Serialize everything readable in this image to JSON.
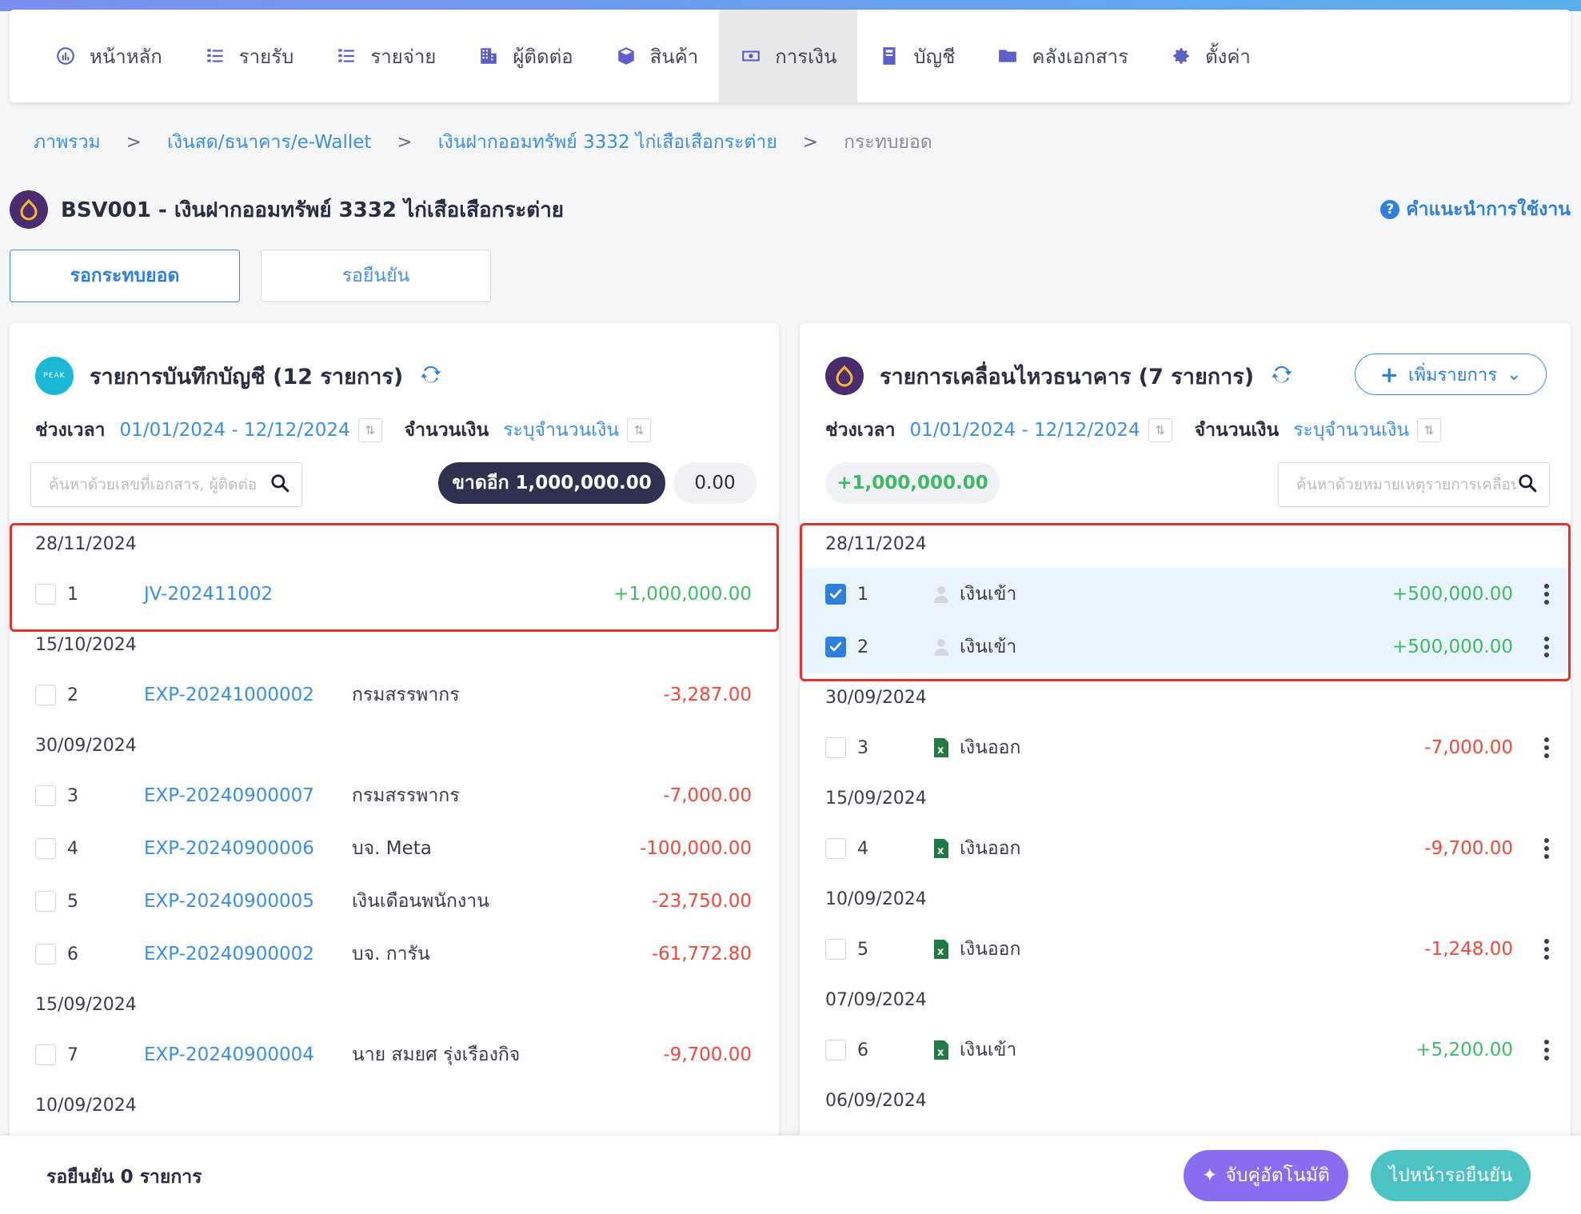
{
  "nav": {
    "items": [
      {
        "label": "หน้าหลัก",
        "icon": "dashboard-icon"
      },
      {
        "label": "รายรับ",
        "icon": "income-list-icon"
      },
      {
        "label": "รายจ่าย",
        "icon": "expense-list-icon"
      },
      {
        "label": "ผู้ติดต่อ",
        "icon": "building-icon"
      },
      {
        "label": "สินค้า",
        "icon": "box-icon"
      },
      {
        "label": "การเงิน",
        "icon": "money-icon",
        "active": true
      },
      {
        "label": "บัญชี",
        "icon": "ledger-icon"
      },
      {
        "label": "คลังเอกสาร",
        "icon": "folder-icon"
      },
      {
        "label": "ตั้งค่า",
        "icon": "gear-icon"
      }
    ]
  },
  "breadcrumb": [
    "ภาพรวม",
    "เงินสด/ธนาคาร/e-Wallet",
    "เงินฝากออมทรัพย์ 3332 ไก่เสือเสือกระต่าย",
    "กระทบยอด"
  ],
  "breadcrumb_sep": ">",
  "page": {
    "title": "BSV001 - เงินฝากออมทรัพย์ 3332 ไก่เสือเสือกระต่าย",
    "help": "คำแนะนำการใช้งาน",
    "help_icon": "?"
  },
  "tabs": {
    "active": "รอกระทบยอด",
    "inactive": "รอยืนยัน"
  },
  "left": {
    "logo_text": "PEAK",
    "title": "รายการบันทึกบัญชี (12 รายการ)",
    "period_label": "ช่วงเวลา",
    "period_value": "01/01/2024 - 12/12/2024",
    "amount_label": "จำนวนเงิน",
    "amount_value": "ระบุจำนวนเงิน",
    "search_placeholder": "ค้นหาด้วยเลขที่เอกสาร, ผู้ติดต่อ",
    "missing": "ขาดอีก 1,000,000.00",
    "total": "0.00",
    "groups": [
      {
        "date": "28/11/2024",
        "rows": [
          {
            "n": "1",
            "doc": "JV-202411002",
            "party": "",
            "amount": "+1,000,000.00",
            "sign": "pos"
          }
        ]
      },
      {
        "date": "15/10/2024",
        "rows": [
          {
            "n": "2",
            "doc": "EXP-20241000002",
            "party": "กรมสรรพากร",
            "amount": "-3,287.00",
            "sign": "neg"
          }
        ]
      },
      {
        "date": "30/09/2024",
        "rows": [
          {
            "n": "3",
            "doc": "EXP-20240900007",
            "party": "กรมสรรพากร",
            "amount": "-7,000.00",
            "sign": "neg"
          },
          {
            "n": "4",
            "doc": "EXP-20240900006",
            "party": "บจ. Meta",
            "amount": "-100,000.00",
            "sign": "neg"
          },
          {
            "n": "5",
            "doc": "EXP-20240900005",
            "party": "เงินเดือนพนักงาน",
            "amount": "-23,750.00",
            "sign": "neg"
          },
          {
            "n": "6",
            "doc": "EXP-20240900002",
            "party": "บจ. การัน",
            "amount": "-61,772.80",
            "sign": "neg"
          }
        ]
      },
      {
        "date": "15/09/2024",
        "rows": [
          {
            "n": "7",
            "doc": "EXP-20240900004",
            "party": "นาย สมยศ รุ่งเรืองกิจ",
            "amount": "-9,700.00",
            "sign": "neg"
          }
        ]
      },
      {
        "date": "10/09/2024",
        "rows": []
      }
    ]
  },
  "right": {
    "title": "รายการเคลื่อนไหวธนาคาร (7 รายการ)",
    "add_label": "เพิ่มรายการ",
    "period_label": "ช่วงเวลา",
    "period_value": "01/01/2024 - 12/12/2024",
    "amount_label": "จำนวนเงิน",
    "amount_value": "ระบุจำนวนเงิน",
    "search_placeholder": "ค้นหาด้วยหมายเหตุรายการเคลื่อนไหว",
    "total": "+1,000,000.00",
    "groups": [
      {
        "date": "28/11/2024",
        "rows": [
          {
            "n": "1",
            "icon": "user-icon",
            "desc": "เงินเข้า",
            "amount": "+500,000.00",
            "sign": "pos",
            "checked": true
          },
          {
            "n": "2",
            "icon": "user-icon",
            "desc": "เงินเข้า",
            "amount": "+500,000.00",
            "sign": "pos",
            "checked": true
          }
        ]
      },
      {
        "date": "30/09/2024",
        "rows": [
          {
            "n": "3",
            "icon": "excel-icon",
            "desc": "เงินออก",
            "amount": "-7,000.00",
            "sign": "neg",
            "checked": false
          }
        ]
      },
      {
        "date": "15/09/2024",
        "rows": [
          {
            "n": "4",
            "icon": "excel-icon",
            "desc": "เงินออก",
            "amount": "-9,700.00",
            "sign": "neg",
            "checked": false
          }
        ]
      },
      {
        "date": "10/09/2024",
        "rows": [
          {
            "n": "5",
            "icon": "excel-icon",
            "desc": "เงินออก",
            "amount": "-1,248.00",
            "sign": "neg",
            "checked": false
          }
        ]
      },
      {
        "date": "07/09/2024",
        "rows": [
          {
            "n": "6",
            "icon": "excel-icon",
            "desc": "เงินเข้า",
            "amount": "+5,200.00",
            "sign": "pos",
            "checked": false
          }
        ]
      },
      {
        "date": "06/09/2024",
        "rows": []
      }
    ]
  },
  "footer": {
    "pending": "รอยืนยัน 0 รายการ",
    "auto_match": "จับคู่อัตโนมัติ",
    "go_confirm": "ไปหน้ารอยืนยัน"
  },
  "colors": {
    "accent": "#2f7fdc",
    "positive": "#3dbb64",
    "negative": "#f0483a",
    "highlight": "#e5322d",
    "auto_button": "#8a6cf0",
    "go_button": "#4cc2c4"
  }
}
